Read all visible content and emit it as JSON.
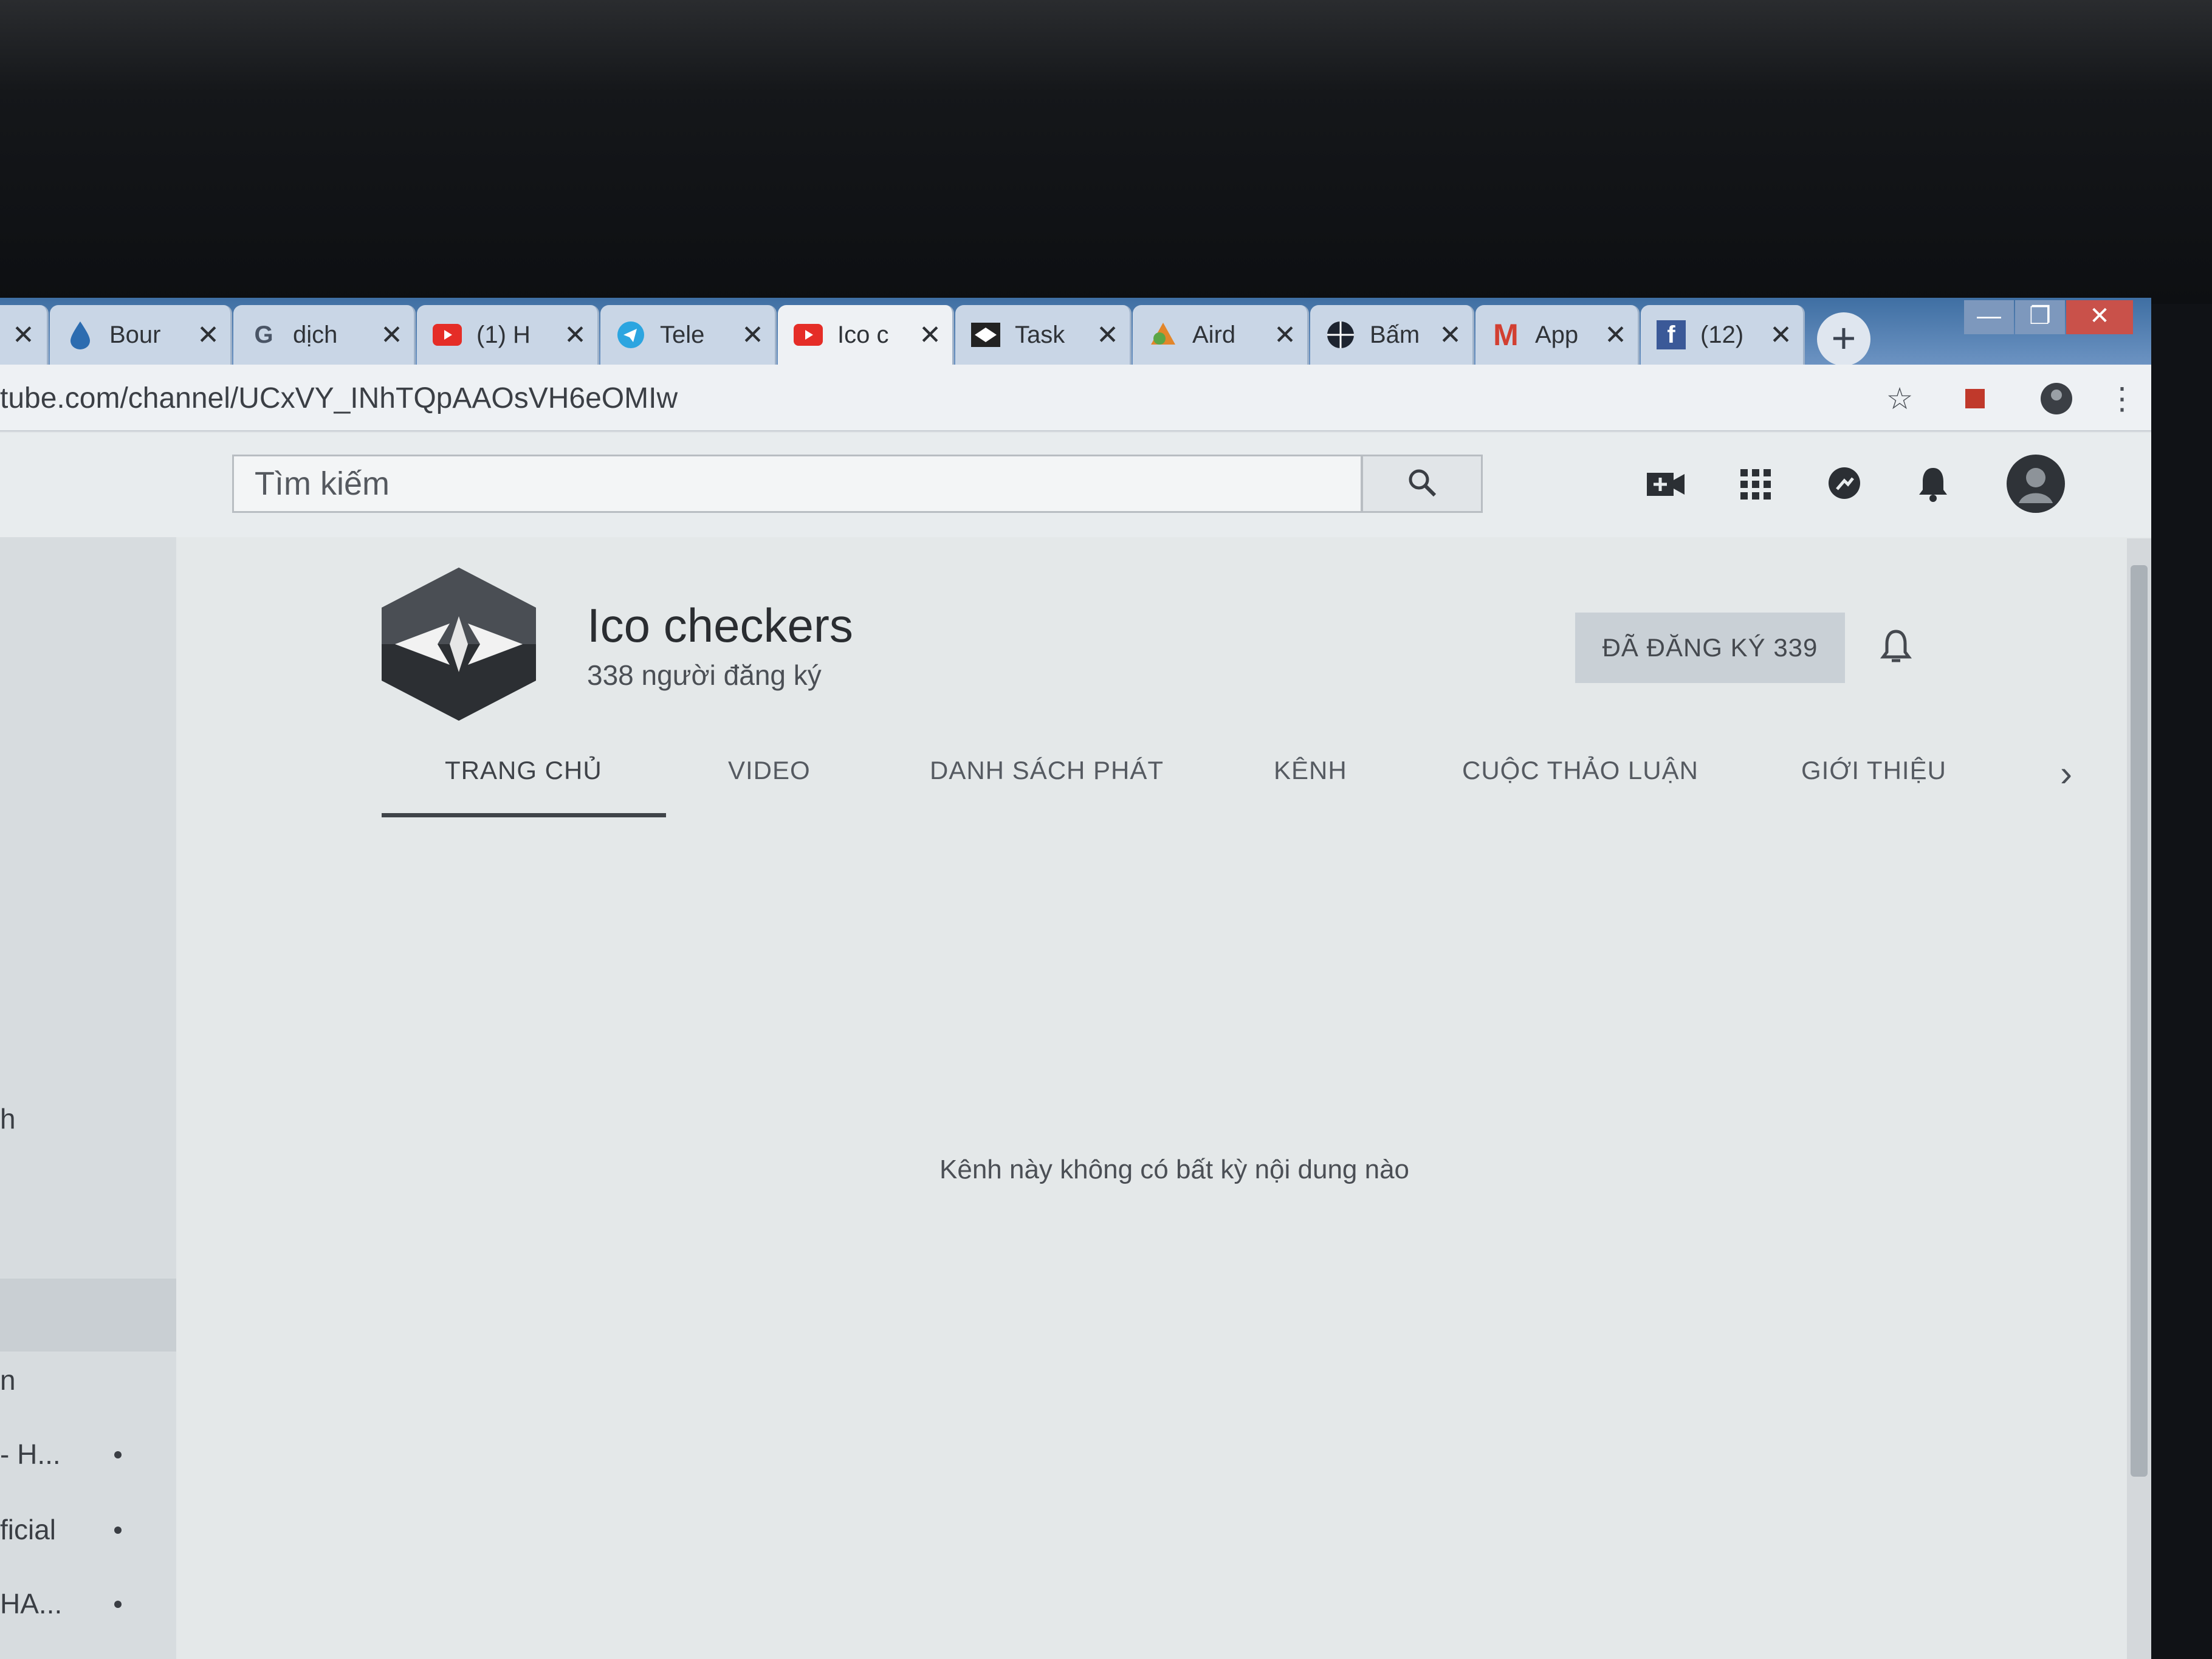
{
  "tabs": [
    {
      "title": "",
      "icon": "close-icon"
    },
    {
      "title": "Bour",
      "icon": "drop-icon"
    },
    {
      "title": "dịch",
      "icon": "google-icon"
    },
    {
      "title": "(1) H",
      "icon": "youtube-icon"
    },
    {
      "title": "Tele",
      "icon": "telegram-icon"
    },
    {
      "title": "Ico c",
      "icon": "youtube-icon"
    },
    {
      "title": "Task",
      "icon": "task-icon"
    },
    {
      "title": "Aird",
      "icon": "airdrop-icon"
    },
    {
      "title": "Bấm",
      "icon": "globe-icon"
    },
    {
      "title": "App",
      "icon": "gmail-icon"
    },
    {
      "title": "(12)",
      "icon": "facebook-icon"
    }
  ],
  "address_bar": {
    "url": "tube.com/channel/UCxVY_INhTQpAAOsVH6eOMIw"
  },
  "header": {
    "search_placeholder": "Tìm kiếm"
  },
  "sidebar": {
    "items": [
      "h",
      "n",
      "- H...",
      "ficial",
      "HA..."
    ]
  },
  "channel": {
    "name": "Ico checkers",
    "subscribers": "338 người đăng ký",
    "subscribe_label": "ĐÃ ĐĂNG KÝ  339",
    "tabs": [
      "TRANG CHỦ",
      "VIDEO",
      "DANH SÁCH PHÁT",
      "KÊNH",
      "CUỘC THẢO LUẬN",
      "GIỚI THIỆU"
    ],
    "active_tab": "TRANG CHỦ",
    "empty_message": "Kênh này không có bất kỳ nội dung nào"
  },
  "colors": {
    "youtube_red": "#e52d27",
    "facebook_blue": "#3b5998",
    "telegram_blue": "#2ca5e0"
  }
}
